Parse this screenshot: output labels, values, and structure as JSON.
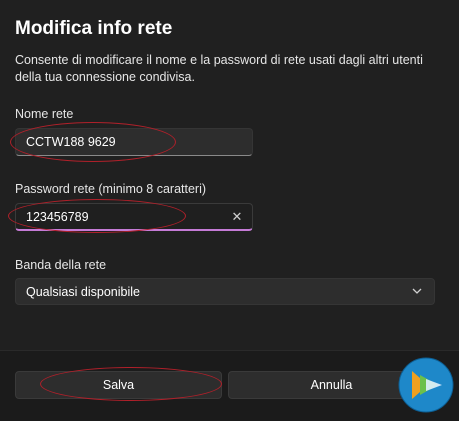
{
  "dialog": {
    "title": "Modifica info rete",
    "description": "Consente di modificare il nome e la password di rete usati dagli altri utenti della tua connessione condivisa."
  },
  "network_name": {
    "label": "Nome rete",
    "value": "CCTW188 9629"
  },
  "password": {
    "label": "Password rete (minimo 8 caratteri)",
    "value": "123456789",
    "clear_glyph": "✕"
  },
  "band": {
    "label": "Banda della rete",
    "selected": "Qualsiasi disponibile"
  },
  "footer": {
    "save_label": "Salva",
    "cancel_label": "Annulla"
  },
  "icons": {
    "clear": "close-icon",
    "dropdown": "chevron-down-icon",
    "watermark": "logo-icon"
  },
  "colors": {
    "accent": "#c57bd6",
    "annotation": "#b0202a",
    "background": "#202020"
  }
}
